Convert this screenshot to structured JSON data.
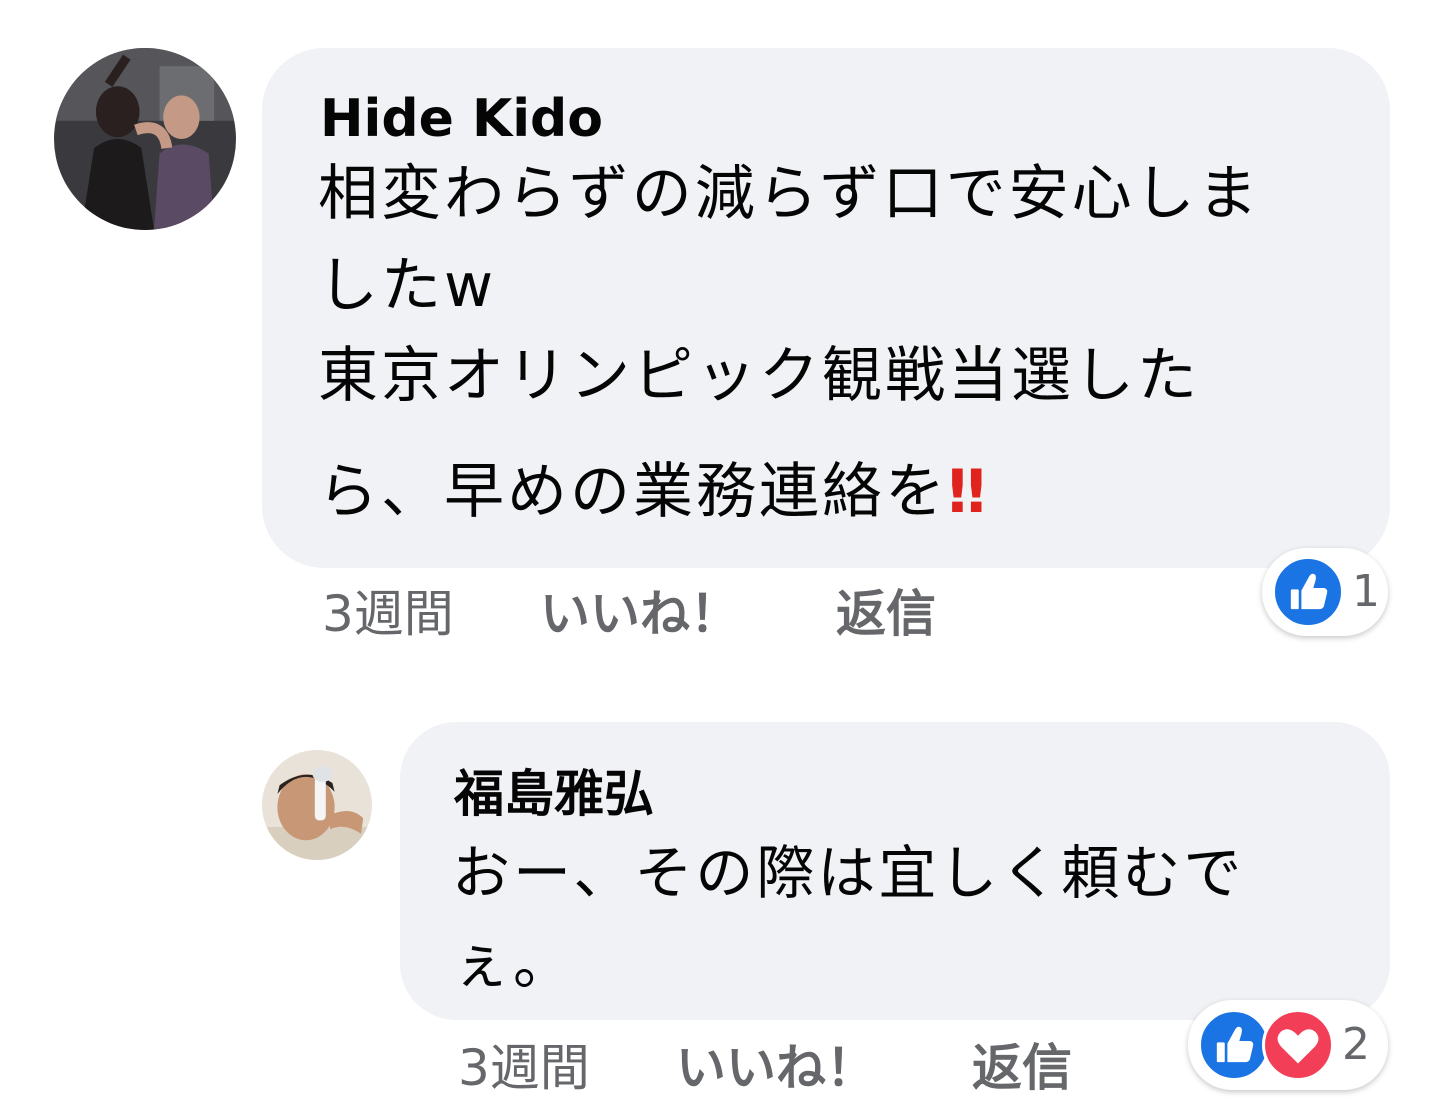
{
  "comments": [
    {
      "author": "Hide Kido",
      "lines": [
        "相変わらずの減らず口で安心しま",
        "したw",
        "東京オリンピック観戦当選した",
        "ら、早めの業務連絡を"
      ],
      "emoji": "‼",
      "time": "3週間",
      "like_label": "いいね！",
      "reply_label": "返信",
      "reaction_count": "1",
      "reactions": [
        "like-icon"
      ]
    },
    {
      "author": "福島雅弘",
      "lines": [
        "おー、その際は宜しく頼むで",
        "ぇ。"
      ],
      "time": "3週間",
      "like_label": "いいね！",
      "reply_label": "返信",
      "reaction_count": "2",
      "reactions": [
        "like-icon",
        "love-icon"
      ]
    }
  ],
  "colors": {
    "bubble": "#f0f2f5",
    "text": "#050505",
    "secondary_text": "#65676b",
    "like_blue": "#1b74e4",
    "love_red": "#f33e58",
    "emoji_red": "#e0231c"
  }
}
